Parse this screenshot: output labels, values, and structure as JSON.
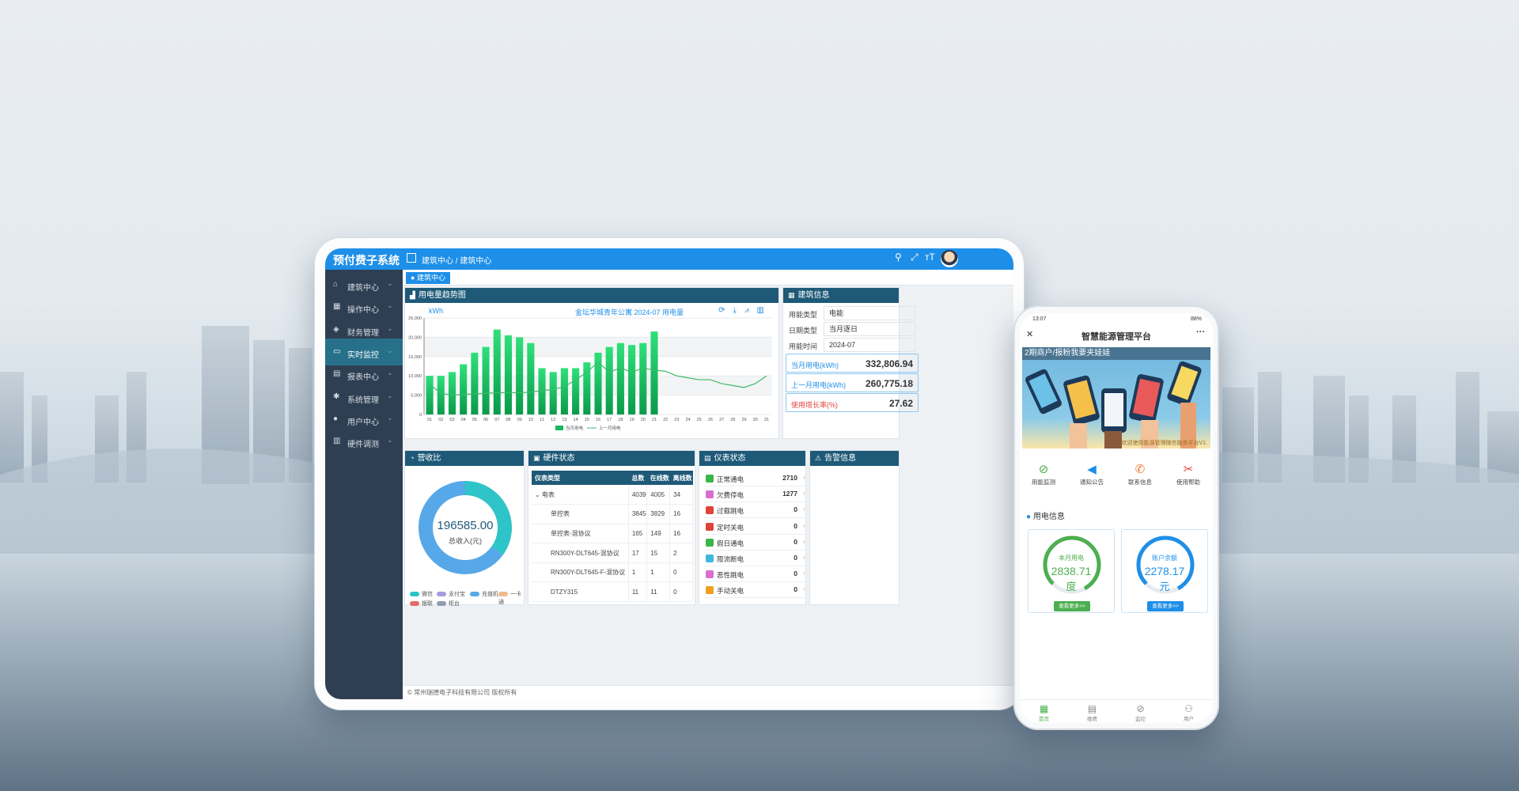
{
  "tablet": {
    "app_title": "预付费子系统",
    "breadcrumb": "建筑中心 / 建筑中心",
    "tab": "建筑中心",
    "sidebar": [
      {
        "icon": "⌂",
        "label": "建筑中心"
      },
      {
        "icon": "▦",
        "label": "操作中心"
      },
      {
        "icon": "◈",
        "label": "财务管理"
      },
      {
        "icon": "▭",
        "label": "实时监控"
      },
      {
        "icon": "▤",
        "label": "报表中心"
      },
      {
        "icon": "✱",
        "label": "系统管理"
      },
      {
        "icon": "●",
        "label": "用户中心"
      },
      {
        "icon": "▥",
        "label": "硬件调测"
      }
    ],
    "trend": {
      "title": "用电量趋势图",
      "unit": "kWh",
      "subtitle": "金坛华城青年公寓    2024-07    用电量"
    },
    "building": {
      "title": "建筑信息",
      "rows": [
        {
          "k": "用能类型",
          "v": "电能"
        },
        {
          "k": "日期类型",
          "v": "当月逐日"
        },
        {
          "k": "用能时间",
          "v": "2024-07"
        }
      ],
      "stats": [
        {
          "k": "当月用电(kWh)",
          "v": "332,806.94",
          "color": "#1e8fe8"
        },
        {
          "k": "上一月用电(kWh)",
          "v": "260,775.18",
          "color": "#1e8fe8"
        },
        {
          "k": "使用增长率(%)",
          "v": "27.62",
          "color": "#e0433a"
        }
      ]
    },
    "revenue": {
      "title": "营收比",
      "total": "196585.00",
      "total_label": "总收入(元)",
      "legend": [
        {
          "name": "微信",
          "color": "#2fc4c8"
        },
        {
          "name": "支付宝",
          "color": "#a79be0"
        },
        {
          "name": "充值机",
          "color": "#57a8e8"
        },
        {
          "name": "一卡通",
          "color": "#f2b98a"
        },
        {
          "name": "银联",
          "color": "#e56b6b"
        },
        {
          "name": "柜台",
          "color": "#8e9bb3"
        }
      ]
    },
    "hardware": {
      "title": "硬件状态",
      "headers": [
        "仪表类型",
        "总数",
        "在线数",
        "离线数"
      ],
      "rows": [
        [
          "⌄ 电表",
          "4039",
          "4005",
          "34"
        ],
        [
          "单控表",
          "3845",
          "3829",
          "16"
        ],
        [
          "单控表-混协议",
          "165",
          "149",
          "16"
        ],
        [
          "RN300Y-DLT645-混协议",
          "17",
          "15",
          "2"
        ],
        [
          "RN300Y-DLT645-F-混协议",
          "1",
          "1",
          "0"
        ],
        [
          "DTZY315",
          "11",
          "11",
          "0"
        ]
      ]
    },
    "meter": {
      "title": "仪表状态",
      "rows": [
        {
          "k": "正常通电",
          "v": "2710",
          "color": "#3bb54a"
        },
        {
          "k": "欠费停电",
          "v": "1277",
          "color": "#d86fd0"
        },
        {
          "k": "过载跳电",
          "v": "0",
          "color": "#e0433a"
        },
        {
          "k": "定时关电",
          "v": "0",
          "color": "#e0433a"
        },
        {
          "k": "假日通电",
          "v": "0",
          "color": "#3bb54a"
        },
        {
          "k": "限流断电",
          "v": "0",
          "color": "#3fb8e0"
        },
        {
          "k": "恶性跳电",
          "v": "0",
          "color": "#d86fd0"
        },
        {
          "k": "手动关电",
          "v": "0",
          "color": "#f0a020"
        }
      ]
    },
    "alarm": {
      "title": "告警信息"
    },
    "footer": "© 常州瑞德电子科技有限公司 版权所有"
  },
  "phone": {
    "status_time": "13:07",
    "status_right": "88%",
    "title": "智慧能源管理平台",
    "banner_caption": "2期商户/报粉我要夹娃娃",
    "banner_tip": "欢迎使用能源管理微信服务平台V1.",
    "icons": [
      {
        "icon": "⊘",
        "label": "用能监测",
        "color": "#4caf50"
      },
      {
        "icon": "◀",
        "label": "通知公告",
        "color": "#1e8fe8"
      },
      {
        "icon": "✆",
        "label": "联系信息",
        "color": "#f07a2a"
      },
      {
        "icon": "✂",
        "label": "使用帮助",
        "color": "#e0433a"
      }
    ],
    "section": "用电信息",
    "cards": [
      {
        "label": "本月用电",
        "value": "2838.71",
        "unit": "度",
        "button": "查看更多>>"
      },
      {
        "label": "账户余额",
        "value": "2278.17",
        "unit": "元",
        "button": "查看更多>>"
      }
    ],
    "bottom_nav": [
      "首页",
      "缴费",
      "监控",
      "用户"
    ]
  },
  "chart_data": [
    {
      "type": "bar",
      "title": "用电量趋势图",
      "ylabel": "kWh",
      "ylim": [
        0,
        25000
      ],
      "yticks": [
        "0",
        "5,000",
        "10,000",
        "15,000",
        "20,000",
        "25,000"
      ],
      "categories": [
        "01",
        "02",
        "03",
        "04",
        "05",
        "06",
        "07",
        "08",
        "09",
        "10",
        "11",
        "12",
        "13",
        "14",
        "15",
        "16",
        "17",
        "18",
        "19",
        "20",
        "21",
        "22",
        "23",
        "24",
        "25",
        "26",
        "27",
        "28",
        "29",
        "30",
        "31"
      ],
      "series": [
        {
          "name": "当月用电",
          "type": "bar",
          "values": [
            10000,
            10000,
            11000,
            13000,
            16000,
            17500,
            22000,
            20500,
            20000,
            18500,
            12000,
            11000,
            12000,
            12000,
            13500,
            16000,
            17500,
            18500,
            18000,
            18500,
            21500,
            null,
            null,
            null,
            null,
            null,
            null,
            null,
            null,
            null,
            null
          ]
        },
        {
          "name": "上一月用电",
          "type": "line",
          "values": [
            7800,
            5500,
            5000,
            5200,
            5300,
            5500,
            5600,
            5700,
            5600,
            5800,
            6200,
            6500,
            7200,
            9000,
            11000,
            13500,
            11000,
            12000,
            11000,
            12000,
            11500,
            11200,
            10000,
            9500,
            9000,
            9000,
            8000,
            7500,
            7000,
            8000,
            10000
          ]
        }
      ],
      "grid": true
    },
    {
      "type": "pie",
      "title": "营收比",
      "categories": [
        "微信",
        "支付宝",
        "充值机",
        "一卡通",
        "银联",
        "柜台"
      ],
      "values": [
        0.35,
        0,
        0.65,
        0,
        0,
        0
      ]
    }
  ]
}
